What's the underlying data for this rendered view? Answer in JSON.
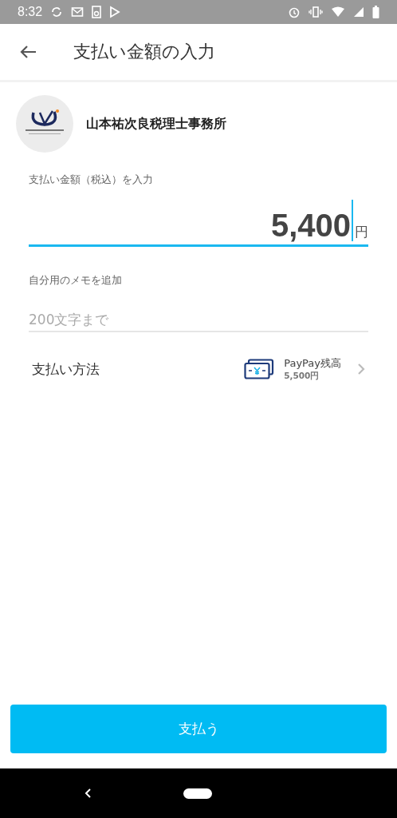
{
  "status_bar": {
    "time": "8:32"
  },
  "header": {
    "title": "支払い金額の入力"
  },
  "merchant": {
    "name": "山本祐次良税理士事務所"
  },
  "amount": {
    "label": "支払い金額（税込）を入力",
    "value": "5,400",
    "unit": "円",
    "focused": true
  },
  "memo": {
    "label": "自分用のメモを追加",
    "placeholder": "200文字まで"
  },
  "payment_method": {
    "label": "支払い方法",
    "method": "PayPay残高",
    "balance": "5,500円"
  },
  "pay_button": {
    "label": "支払う"
  }
}
